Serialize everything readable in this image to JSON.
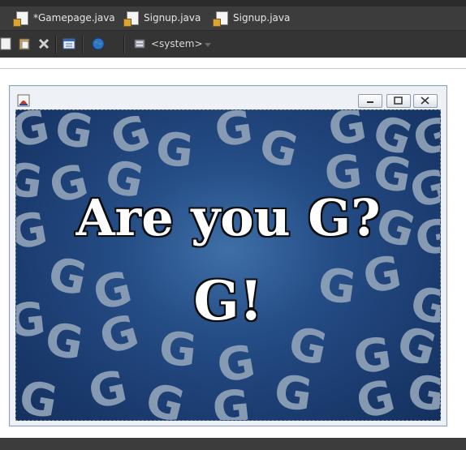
{
  "editor_tabs": [
    {
      "label": "*Gamepage.java"
    },
    {
      "label": "Signup.java"
    },
    {
      "label": "Signup.java"
    }
  ],
  "toolbar": {
    "system_combo_value": "<system>"
  },
  "game_window": {
    "headline": "Are you G?",
    "answer": "G!",
    "pattern_letter": "G"
  }
}
